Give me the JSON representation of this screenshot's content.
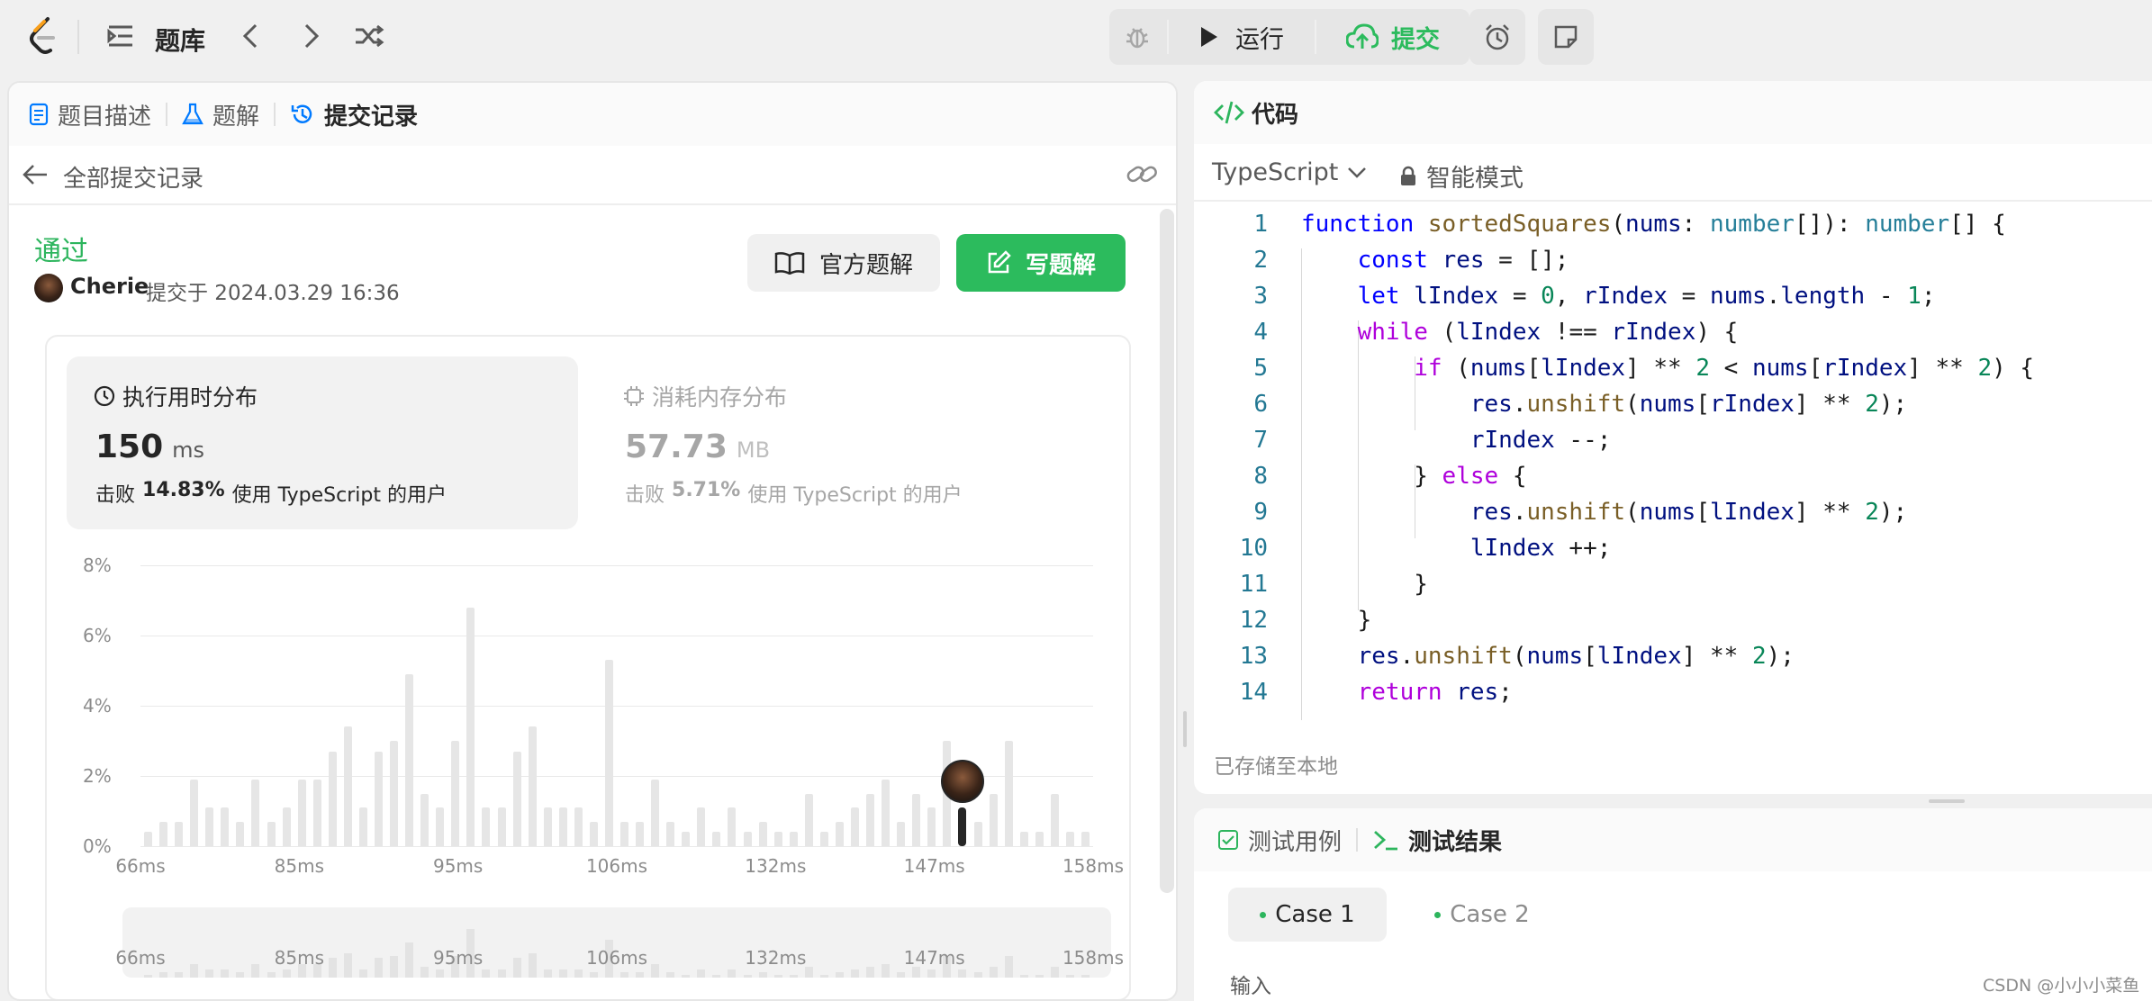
{
  "topbar": {
    "problem_bank": "题库",
    "run": "运行",
    "submit": "提交"
  },
  "left_tabs": [
    {
      "label": "题目描述"
    },
    {
      "label": "题解"
    },
    {
      "label": "提交记录"
    }
  ],
  "submissions": {
    "back_label": "全部提交记录"
  },
  "result": {
    "status": "通过",
    "user": "Cherie",
    "submitted_at": "提交于 2024.03.29 16:36",
    "official_solution": "官方题解",
    "write_solution": "写题解"
  },
  "runtime": {
    "title": "执行用时分布",
    "value": "150",
    "unit": "ms",
    "beat_prefix": "击败",
    "beat_pct": "14.83%",
    "beat_suffix": "使用 TypeScript 的用户"
  },
  "memory": {
    "title": "消耗内存分布",
    "value": "57.73",
    "unit": "MB",
    "beat_prefix": "击败",
    "beat_pct": "5.71%",
    "beat_suffix": "使用 TypeScript 的用户"
  },
  "chart_data": {
    "type": "bar",
    "ylim": [
      0,
      8
    ],
    "y_ticks": [
      "8%",
      "6%",
      "4%",
      "2%",
      "0%"
    ],
    "x_ticks": [
      "66ms",
      "85ms",
      "95ms",
      "106ms",
      "132ms",
      "147ms",
      "158ms"
    ],
    "values": [
      0.4,
      0.7,
      0.7,
      1.9,
      1.1,
      1.1,
      0.7,
      1.9,
      0.7,
      1.1,
      1.9,
      1.9,
      2.7,
      3.4,
      1.1,
      2.7,
      3.0,
      4.9,
      1.5,
      1.1,
      3.0,
      6.8,
      1.1,
      1.1,
      2.7,
      3.4,
      1.1,
      1.1,
      1.1,
      0.7,
      5.3,
      0.7,
      0.7,
      1.9,
      0.7,
      0.4,
      1.1,
      0.4,
      1.1,
      0.4,
      0.7,
      0.4,
      0.4,
      1.5,
      0.4,
      0.7,
      1.1,
      1.5,
      1.9,
      0.7,
      1.5,
      1.1,
      3.0,
      1.1,
      0.7,
      1.5,
      3.0,
      0.4,
      0.4,
      1.5,
      0.4,
      0.4
    ],
    "highlight_index": 53,
    "grid": true
  },
  "editor": {
    "title": "代码",
    "language": "TypeScript",
    "mode": "智能模式",
    "saved": "已存储至本地",
    "line_numbers": [
      "1",
      "2",
      "3",
      "4",
      "5",
      "6",
      "7",
      "8",
      "9",
      "10",
      "11",
      "12",
      "13",
      "14"
    ]
  },
  "bottom": {
    "tab_testcase": "测试用例",
    "tab_result": "测试结果",
    "cases": [
      "Case 1",
      "Case 2"
    ],
    "input_label": "输入"
  },
  "watermark": "CSDN @小小小菜鱼",
  "colors": {
    "accent_green": "#2db55d",
    "button_green": "#2cbb5d",
    "link_blue": "#007aff"
  }
}
